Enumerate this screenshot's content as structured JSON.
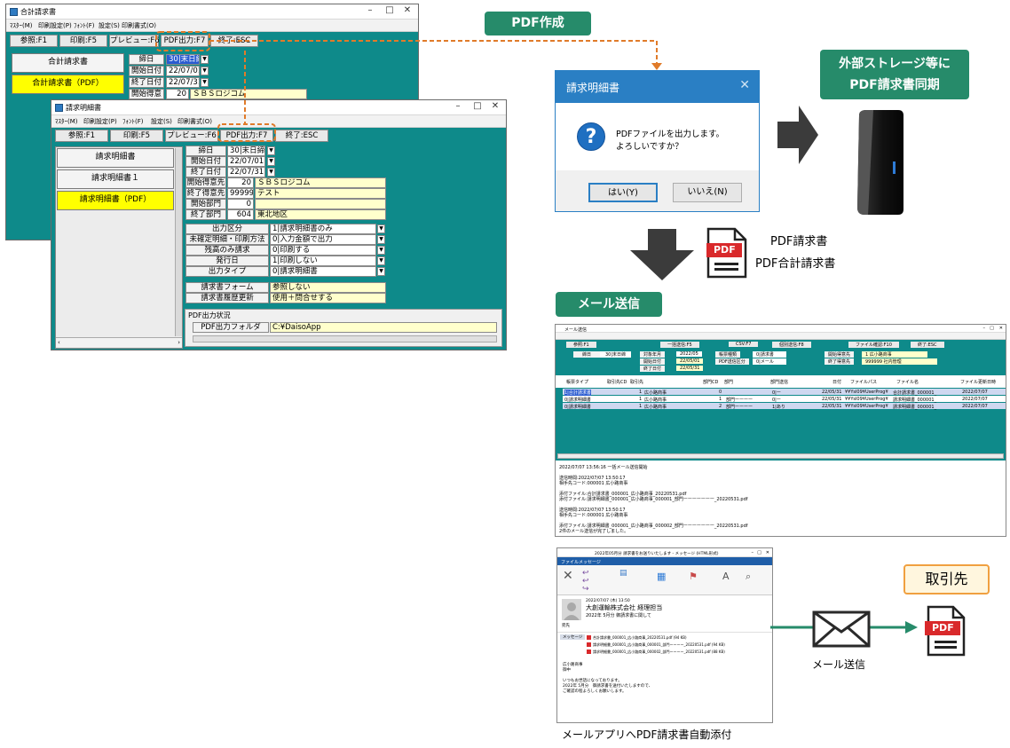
{
  "win1": {
    "title": "合計請求書",
    "menu": [
      "ﾏｽﾀｰ(M)",
      "印刷設定(P)",
      "ﾌｫﾝﾄ(F)",
      "設定(S)",
      "印刷書式(O)"
    ],
    "fkeys": [
      "参照:F1",
      "印刷:F5",
      "プレビュー:F6",
      "PDF出力:F7",
      "終了:ESC"
    ],
    "nav": [
      "合計請求書",
      "合計請求書（PDF）"
    ],
    "rows": [
      {
        "label": "締日",
        "value": "30|末日締"
      },
      {
        "label": "開始日付",
        "value": "22/07/01"
      },
      {
        "label": "終了日付",
        "value": "22/07/31"
      },
      {
        "label": "開始得意先",
        "code": "20",
        "name": "ＳＢＳロジコム"
      }
    ]
  },
  "win2": {
    "title": "請求明細書",
    "menu": [
      "ﾏｽﾀｰ(M)",
      "印刷設定(P)",
      "ﾌｫﾝﾄ(F)",
      "設定(S)",
      "印刷書式(O)"
    ],
    "fkeys": [
      "参照:F1",
      "印刷:F5",
      "プレビュー:F6",
      "PDF出力:F7",
      "終了:ESC"
    ],
    "nav": [
      "請求明細書",
      "請求明細書１",
      "請求明細書（PDF）"
    ],
    "rows": [
      {
        "label": "締日",
        "value": "30|末日締"
      },
      {
        "label": "開始日付",
        "value": "22/07/01"
      },
      {
        "label": "終了日付",
        "value": "22/07/31"
      },
      {
        "label": "開始得意先",
        "code": "20",
        "name": "ＳＢＳロジコム"
      },
      {
        "label": "終了得意先",
        "code": "999999",
        "name": "テスト"
      },
      {
        "label": "開始部門",
        "code": "0",
        "name": ""
      },
      {
        "label": "終了部門",
        "code": "604",
        "name": "東北地区"
      }
    ],
    "options": [
      {
        "label": "出力区分",
        "value": "1|請求明細書のみ"
      },
      {
        "label": "未確定明細・印刷方法",
        "value": "0|入力金額で出力"
      },
      {
        "label": "残高のみ請求",
        "value": "0|印刷する"
      },
      {
        "label": "発行日",
        "value": "1|印刷しない"
      },
      {
        "label": "出力タイプ",
        "value": "0|請求明細書"
      }
    ],
    "form": [
      {
        "label": "請求書フォーム",
        "value": "参照しない"
      },
      {
        "label": "請求書履歴更新",
        "value": "使用＋問合せする"
      }
    ],
    "pdf_status": "PDF出力状況",
    "pdf_folder_label": "PDF出力フォルダ",
    "pdf_folder_value": "C:¥DaisoApp"
  },
  "pdf_create_tag": "PDF作成",
  "dialog": {
    "title": "請求明細書",
    "line1": "PDFファイルを出力します。",
    "line2": "よろしいですか？",
    "yes": "はい(Y)",
    "no": "いいえ(N)"
  },
  "storage_tag_line1": "外部ストレージ等に",
  "storage_tag_line2": "PDF請求書同期",
  "pdf_file_label": "PDF",
  "pdf_output_line1": "PDF請求書",
  "pdf_output_line2": "PDF合計請求書",
  "mail_send_tag": "メール送信",
  "mail_window": {
    "title": "メール送信",
    "fkeys": [
      "参照:F1",
      "一括送信:F5",
      "CSV:F7",
      "個別送信:F8",
      "ファイル確認:F10",
      "終了:ESC"
    ],
    "header_rows": [
      {
        "label": "締日",
        "value": "30|末日締"
      },
      {
        "label": "対象年月",
        "value": "2022/05"
      },
      {
        "label": "開始日付",
        "value": "22/05/01"
      },
      {
        "label": "終了日付",
        "value": "22/05/31"
      },
      {
        "label": "帳票種類",
        "value": "0|請求書"
      },
      {
        "label": "PDF送信区分",
        "value": "0|メール"
      },
      {
        "label": "開始得意先",
        "value": "1 広小路商事"
      },
      {
        "label": "終了得意先",
        "value": "999999 社内管理"
      }
    ],
    "columns": [
      "帳票タイプ",
      "取引先CD",
      "取引先",
      "部門CD",
      "部門",
      "部門送信",
      "日付",
      "ファイルパス",
      "ファイル名",
      "ファイル更新日時"
    ],
    "rows": [
      [
        "1|合計請求書",
        "1",
        "広小路商事",
        "0",
        "",
        "0|ー",
        "22/05/31",
        "¥¥Ysl09¥UserProg¥",
        "合計請求書_000001_",
        "2022/07/07"
      ],
      [
        "0|請求明細書",
        "1",
        "広小路商事",
        "1",
        "部門ーーーー",
        "0|ー",
        "22/05/31",
        "¥¥Ysl09¥UserProg¥",
        "請求明細書_000001_",
        "2022/07/07"
      ],
      [
        "0|請求明細書",
        "1",
        "広小路商事",
        "2",
        "部門ーーーー",
        "1|あり",
        "22/05/31",
        "¥¥Ysl09¥UserProg¥",
        "請求明細書_000001_",
        "2022/07/07"
      ]
    ],
    "log_lines": [
      "2022/07/07 13:56:16  一括メール送信開始",
      "送信時間:2022/07/07 13:50:17",
      "  相手先コード:000001 広小路商事",
      "  添付ファイル:合計請求書_000001_広小路商事_20220531.pdf",
      "  添付ファイル:請求明細書_000001_広小路商事_000001_部門ーーーーーーー_20220531.pdf",
      "送信時間:2022/07/07 13:50:17",
      "  相手先コード:000001 広小路商事",
      "  添付ファイル:請求明細書_000001_広小路商事_000002_部門ーーーーーーー_20220531.pdf",
      "2件のメール送信が完了しました。"
    ]
  },
  "mail_app": {
    "window_title": "2022年05月分 請求書をお送りいたします - メッセージ (HTML形式)",
    "tabs": [
      "ファイル",
      "メッセージ"
    ],
    "date": "2022/07/07 (木) 13:50",
    "sender": "大創運輸株式会社 経理担当",
    "subject": "2022年 5月分 御請求書に関して",
    "to_label": "宛先",
    "attach_label": "メッセージ",
    "attachments": [
      "合計請求書_000001_広小路商事_20220531.pdf (94 KB)",
      "請求明細書_000001_広小路商事_000001_部門ーーーー_20220531.pdf (94 KB)",
      "請求明細書_000001_広小路商事_000002_部門ーーーー_20220531.pdf (88 KB)"
    ],
    "body": [
      "広小路商事",
      "御中",
      "いつもお世話になっております。",
      "2022年 5月分　御請求書を送付いたしますので、",
      "ご確認の程よろしくお願いします。"
    ]
  },
  "mail_app_caption": "メールアプリへPDF請求書自動添付",
  "mail_send_caption": "メール送信",
  "partner_tag": "取引先",
  "colors": {
    "teal": "#0e8a8a",
    "green_tag": "#268b6a",
    "orange_dash": "#e07b2a",
    "dialog_blue": "#2a7fc4",
    "pdf_red": "#d9292b",
    "arrow_gray": "#3b3b3b"
  }
}
